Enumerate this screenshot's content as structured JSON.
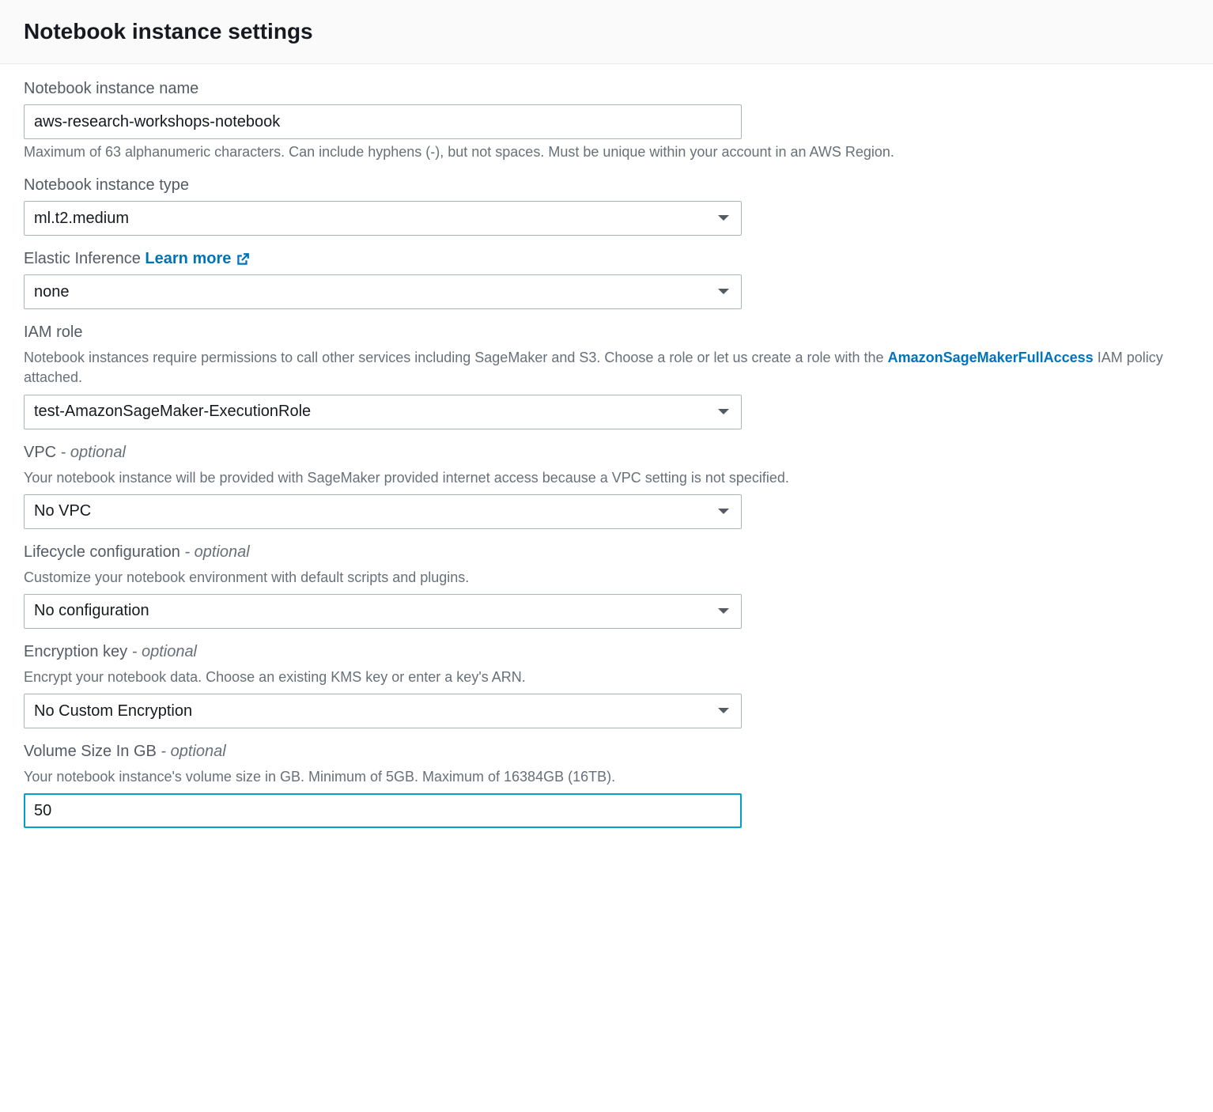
{
  "header": {
    "title": "Notebook instance settings"
  },
  "fields": {
    "instanceName": {
      "label": "Notebook instance name",
      "value": "aws-research-workshops-notebook",
      "help": "Maximum of 63 alphanumeric characters. Can include hyphens (-), but not spaces. Must be unique within your account in an AWS Region."
    },
    "instanceType": {
      "label": "Notebook instance type",
      "value": "ml.t2.medium"
    },
    "elasticInference": {
      "label": "Elastic Inference",
      "learnMore": "Learn more",
      "value": "none"
    },
    "iamRole": {
      "label": "IAM role",
      "descPrefix": "Notebook instances require permissions to call other services including SageMaker and S3. Choose a role or let us create a role with the ",
      "policyLink": "AmazonSageMakerFullAccess",
      "descSuffix": " IAM policy attached.",
      "value": "test-AmazonSageMaker-ExecutionRole"
    },
    "vpc": {
      "label": "VPC",
      "optional": " - optional",
      "desc": "Your notebook instance will be provided with SageMaker provided internet access because a VPC setting is not specified.",
      "value": "No VPC"
    },
    "lifecycle": {
      "label": "Lifecycle configuration",
      "optional": " - optional",
      "desc": "Customize your notebook environment with default scripts and plugins.",
      "value": "No configuration"
    },
    "encryption": {
      "label": "Encryption key",
      "optional": " - optional",
      "desc": "Encrypt your notebook data. Choose an existing KMS key or enter a key's ARN.",
      "value": "No Custom Encryption"
    },
    "volumeSize": {
      "label": "Volume Size In GB",
      "optional": " - optional",
      "desc": "Your notebook instance's volume size in GB. Minimum of 5GB. Maximum of 16384GB (16TB).",
      "value": "50"
    }
  }
}
